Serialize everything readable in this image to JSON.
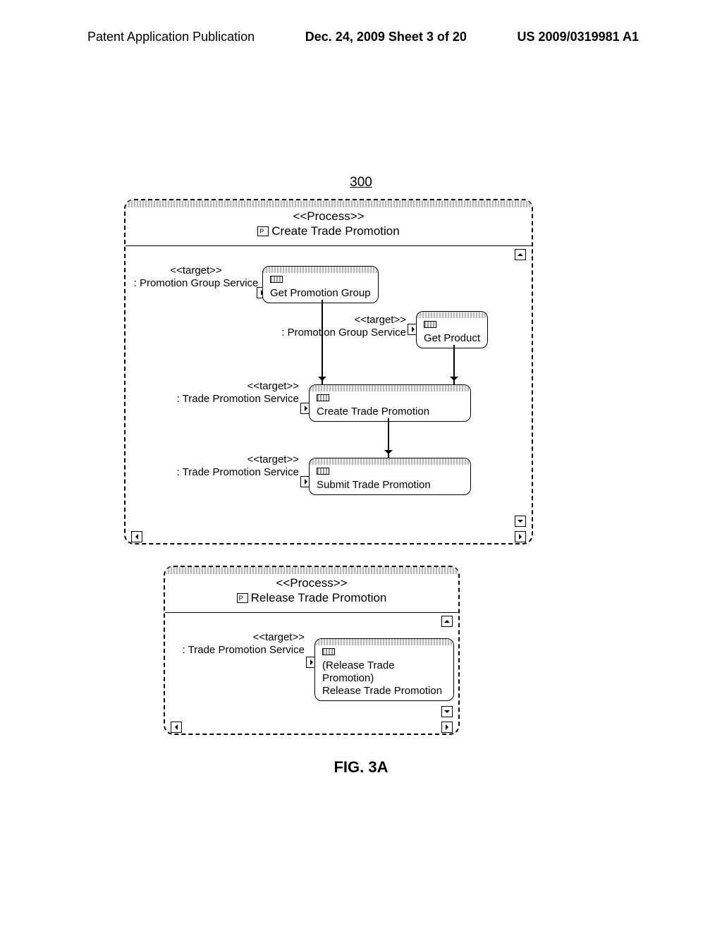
{
  "header": {
    "left": "Patent Application Publication",
    "center": "Dec. 24, 2009  Sheet 3 of 20",
    "right": "US 2009/0319981 A1"
  },
  "figure_ref": "300",
  "figure_caption": "FIG. 3A",
  "processes": [
    {
      "stereotype": "<<Process>>",
      "name": "Create Trade Promotion",
      "steps": [
        {
          "target_stereotype": "<<target>>",
          "target_name": ": Promotion Group Service",
          "activity": "Get Promotion Group"
        },
        {
          "target_stereotype": "<<target>>",
          "target_name": ": Promotion Group Service",
          "activity": "Get Product"
        },
        {
          "target_stereotype": "<<target>>",
          "target_name": ": Trade Promotion Service",
          "activity": "Create Trade Promotion"
        },
        {
          "target_stereotype": "<<target>>",
          "target_name": ": Trade Promotion Service",
          "activity": "Submit Trade Promotion"
        }
      ]
    },
    {
      "stereotype": "<<Process>>",
      "name": "Release Trade Promotion",
      "steps": [
        {
          "target_stereotype": "<<target>>",
          "target_name": ": Trade Promotion Service",
          "activity_note": "(Release Trade Promotion)",
          "activity": "Release Trade Promotion"
        }
      ]
    }
  ]
}
